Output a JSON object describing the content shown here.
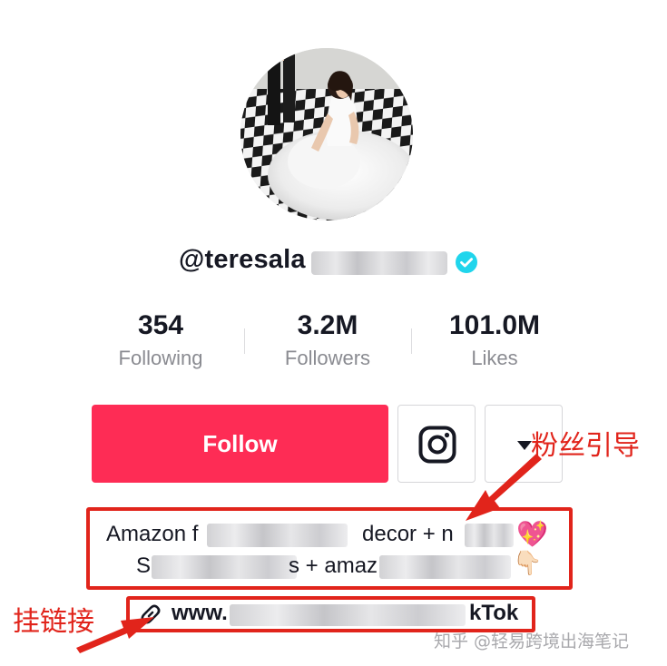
{
  "profile": {
    "username_visible": "@teresala",
    "verified": true,
    "accent_color": "#fe2c55",
    "verified_color": "#20d5ec"
  },
  "stats": [
    {
      "value": "354",
      "label": "Following"
    },
    {
      "value": "3.2M",
      "label": "Followers"
    },
    {
      "value": "101.0M",
      "label": "Likes"
    }
  ],
  "actions": {
    "follow_label": "Follow",
    "instagram_icon": "instagram-icon",
    "more_icon": "caret-down-icon"
  },
  "bio": {
    "line1_start": "Amazon f",
    "line1_mid": "decor + n",
    "line1_emoji": "💖",
    "line2_start": "S",
    "line2_mid": "s + amaz",
    "line2_emoji": "👇🏻"
  },
  "link": {
    "prefix": "www.",
    "suffix": "kTok",
    "icon": "link-icon"
  },
  "annotations": {
    "fan_guide": "粉丝引导",
    "attach_link": "挂链接",
    "color": "#e1241b"
  },
  "watermark": "知乎 @轻易跨境出海笔记"
}
